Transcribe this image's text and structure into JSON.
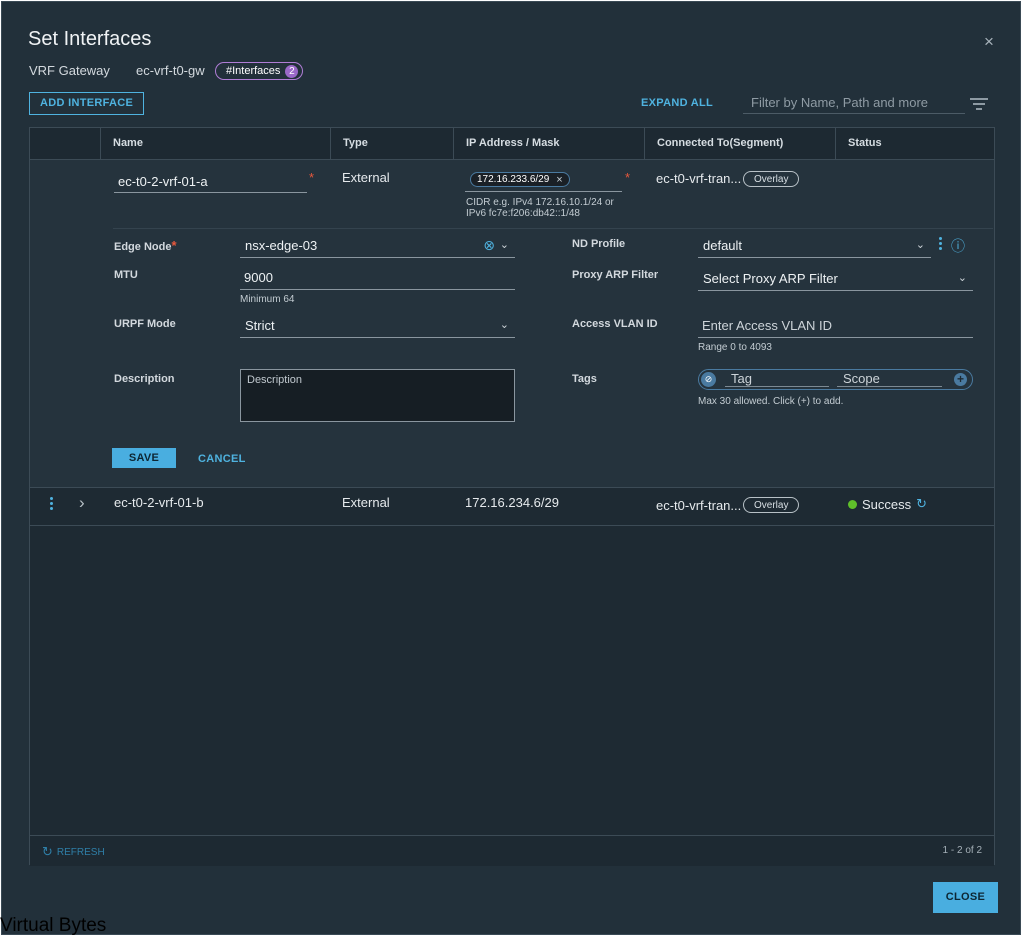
{
  "dialog": {
    "title": "Set Interfaces",
    "close_glyph": "×",
    "vrf_label": "VRF Gateway",
    "vrf_value": "ec-vrf-t0-gw",
    "interfaces_badge": "#Interfaces",
    "interfaces_count": "2"
  },
  "toolbar": {
    "add_interface": "ADD INTERFACE",
    "expand_all": "EXPAND ALL",
    "filter_placeholder": "Filter by Name, Path and more"
  },
  "table": {
    "columns": [
      "Name",
      "Type",
      "IP Address / Mask",
      "Connected To(Segment)",
      "Status"
    ]
  },
  "edit_row": {
    "name_value": "ec-t0-2-vrf-01-a",
    "required_mark": "*",
    "type": "External",
    "ip_chip": "172.16.233.6/29",
    "ip_chip_close": "×",
    "ip_hint_line1": "CIDR e.g. IPv4 172.16.10.1/24 or",
    "ip_hint_line2": "IPv6 fc7e:f206:db42::1/48",
    "segment": "ec-t0-vrf-tran...",
    "segment_badge": "Overlay",
    "edge_node_label": "Edge Node",
    "edge_node_value": "nsx-edge-03",
    "mtu_label": "MTU",
    "mtu_value": "9000",
    "mtu_hint": "Minimum 64",
    "urpf_label": "URPF Mode",
    "urpf_value": "Strict",
    "description_label": "Description",
    "description_placeholder": "Description",
    "nd_profile_label": "ND Profile",
    "nd_profile_value": "default",
    "proxy_arp_label": "Proxy ARP Filter",
    "proxy_arp_value": "Select Proxy ARP Filter",
    "access_vlan_label": "Access VLAN ID",
    "access_vlan_placeholder": "Enter Access VLAN ID",
    "access_vlan_hint": "Range 0 to 4093",
    "tags_label": "Tags",
    "tag_placeholder": "Tag",
    "scope_placeholder": "Scope",
    "tags_hint": "Max 30 allowed. Click (+) to add.",
    "save": "SAVE",
    "cancel": "CANCEL"
  },
  "rows": [
    {
      "name": "ec-t0-2-vrf-01-b",
      "type": "External",
      "ip": "172.16.234.6/29",
      "segment": "ec-t0-vrf-tran...",
      "segment_badge": "Overlay",
      "status": "Success"
    }
  ],
  "footer": {
    "refresh": "REFRESH",
    "pagination": "1 - 2 of 2"
  },
  "close_button": "CLOSE",
  "watermark": "Virtual Bytes",
  "icons": {
    "chevron_down": "⌄",
    "chevron_right": "›",
    "clear": "⊗",
    "info": "ⓘ",
    "refresh": "↻",
    "add": "+",
    "tag": "⊘"
  },
  "colors": {
    "accent": "#49aee0",
    "background": "#22303a",
    "success": "#5fbf2a",
    "required": "#e8583c",
    "badge": "#9a68c8"
  }
}
